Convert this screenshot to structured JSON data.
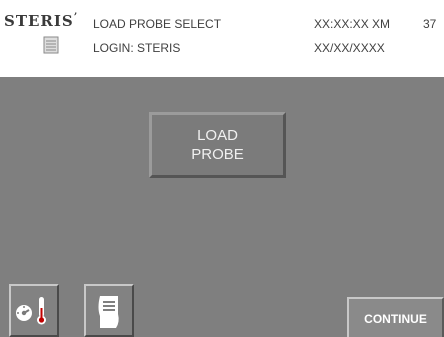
{
  "header": {
    "logo_text": "STERIS",
    "logo_mark": "’",
    "screen_title": "LOAD PROBE SELECT",
    "login": "LOGIN: STERIS",
    "time": "XX:XX:XX XM",
    "date": "XX/XX/XXXX",
    "screen_number": "37"
  },
  "main": {
    "load_probe_line1": "LOAD",
    "load_probe_line2": "PROBE"
  },
  "footer": {
    "settings_icon": "gauge-thermometer-icon",
    "printer_icon": "printer-paper-icon",
    "continue_label": "CONTINUE"
  },
  "colors": {
    "background": "#7f7f7f",
    "header_bg": "#ffffff",
    "text_light": "#ffffff"
  }
}
